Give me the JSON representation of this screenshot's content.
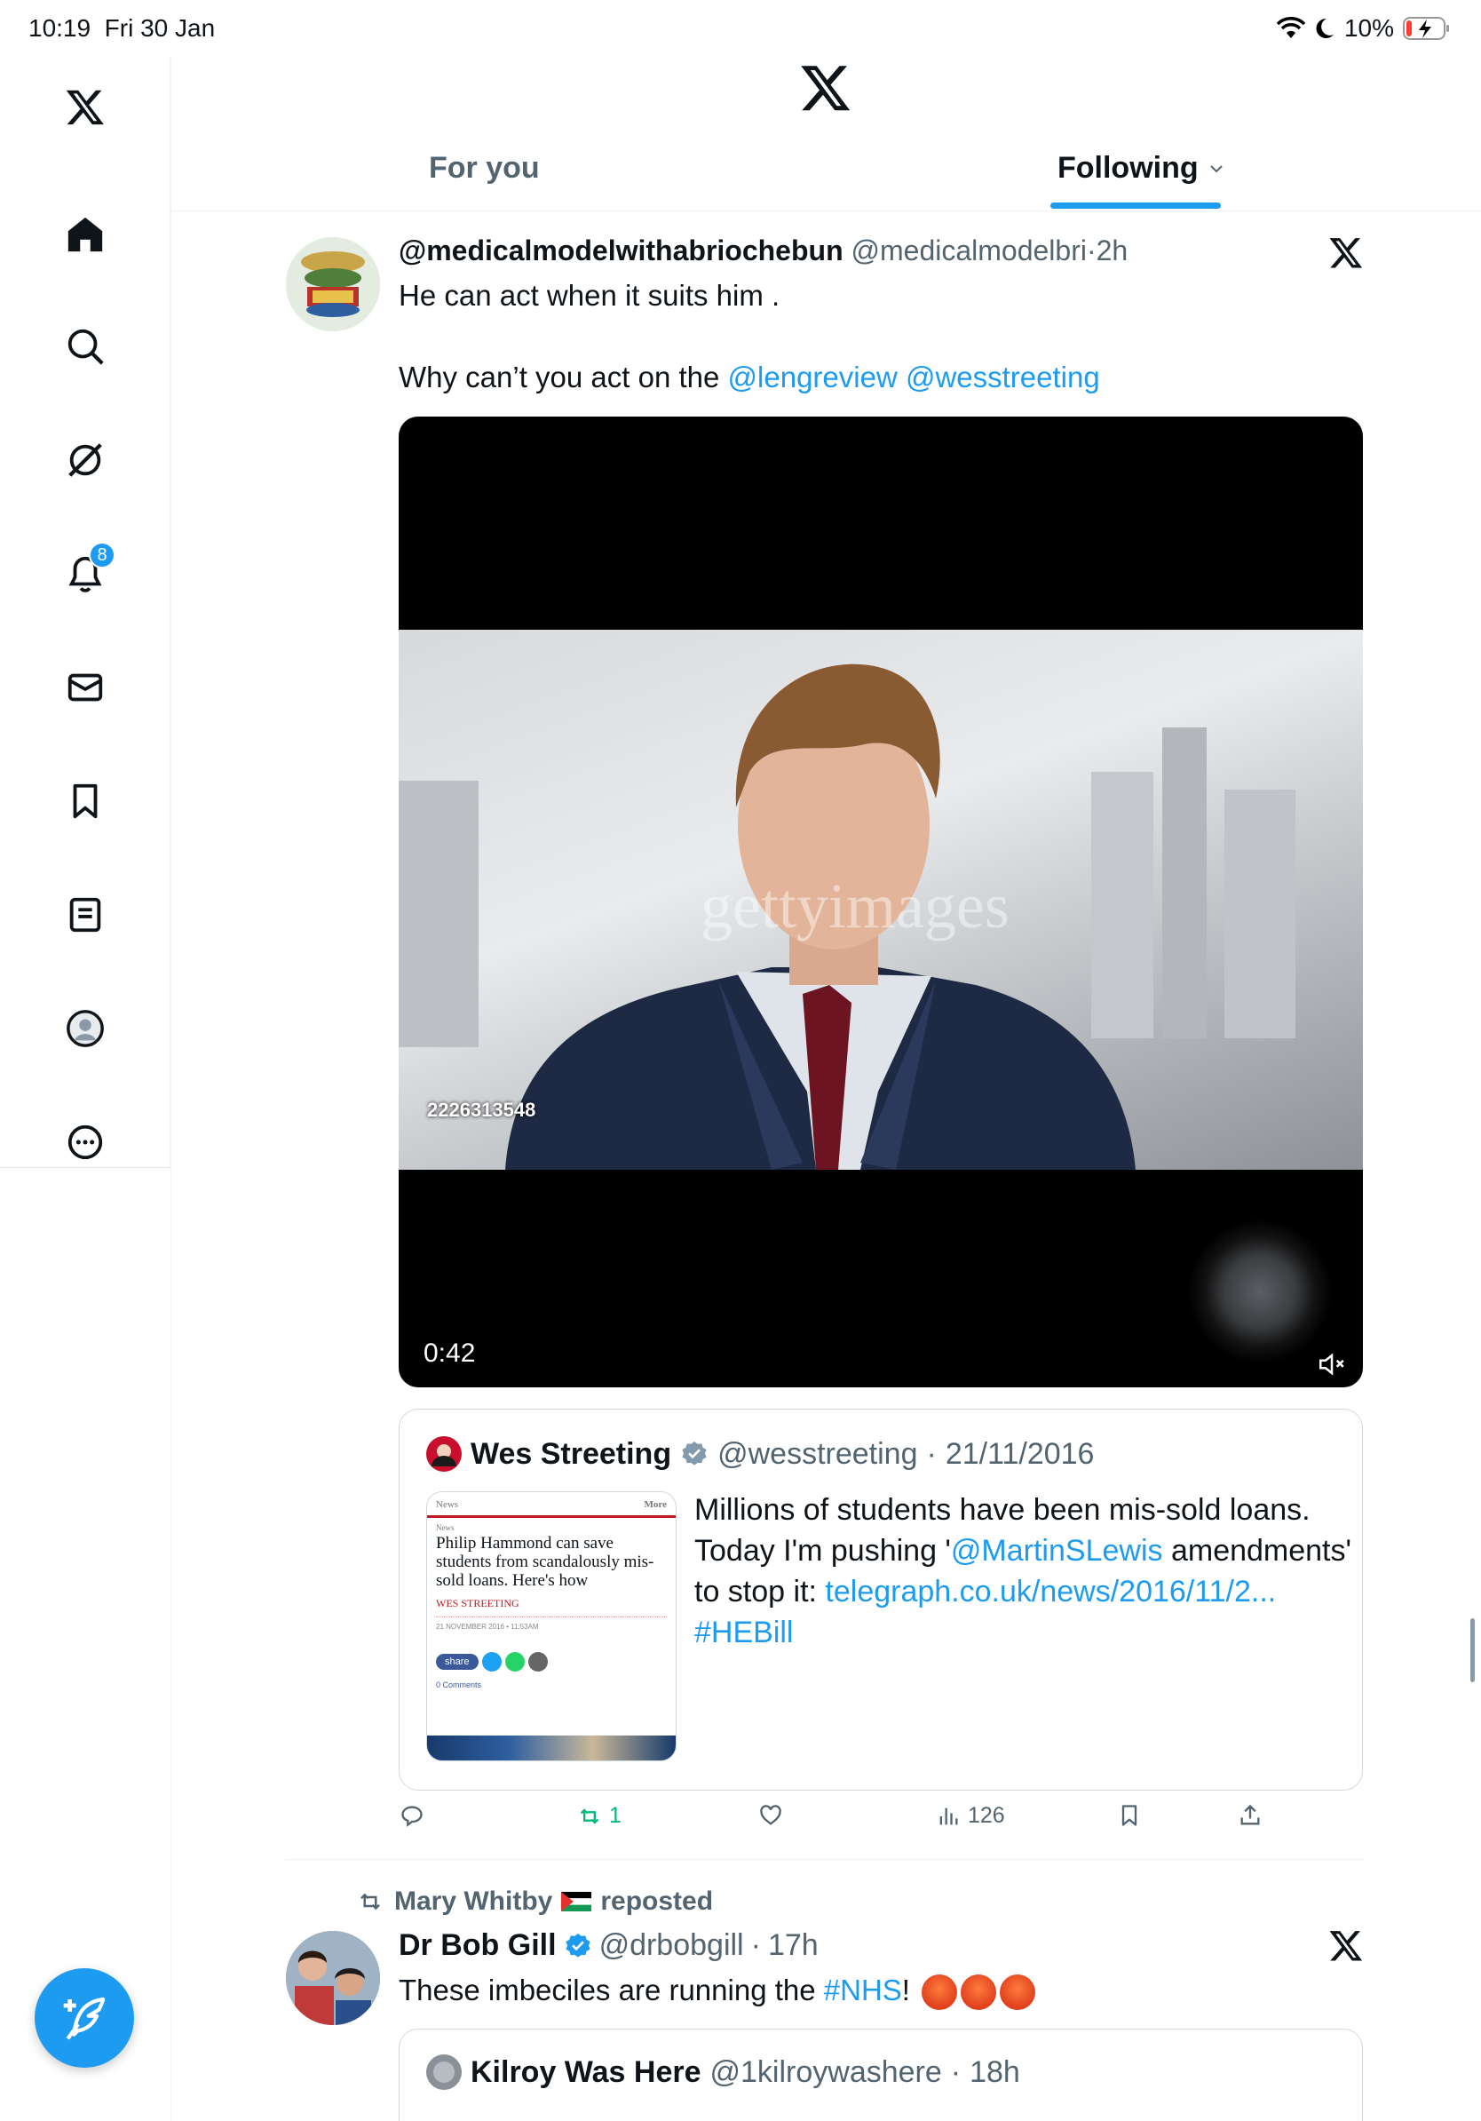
{
  "status_bar": {
    "time": "10:19",
    "date": "Fri 30 Jan",
    "battery": "10%"
  },
  "sidebar": {
    "items": [
      {
        "name": "x-logo-icon"
      },
      {
        "name": "home-icon"
      },
      {
        "name": "search-icon"
      },
      {
        "name": "grok-icon"
      },
      {
        "name": "notifications-icon",
        "badge": "8"
      },
      {
        "name": "messages-icon"
      },
      {
        "name": "bookmarks-icon"
      },
      {
        "name": "lists-icon"
      },
      {
        "name": "profile-icon"
      },
      {
        "name": "more-icon"
      }
    ]
  },
  "tabs": {
    "for_you": "For you",
    "following": "Following"
  },
  "tweet1": {
    "display_name": "@medicalmodelwithabriochebun",
    "handle": "@medicalmodelbri",
    "time": "2h",
    "text_line1": "He can act when it suits him .",
    "text_line2_prefix": "Why can’t you act on the ",
    "mention1": "@lengreview",
    "mention2": "@wesstreeting",
    "video": {
      "duration": "0:42",
      "image_id": "2226313548",
      "watermark": "gettyimages"
    },
    "quote": {
      "name": "Wes Streeting",
      "handle": "@wesstreeting",
      "date": "21/11/2016",
      "text_1": "Millions of students have been mis-sold loans. Today I'm pushing '",
      "mention": "@MartinSLewis",
      "text_2": " amendments' to stop it: ",
      "link": "telegraph.co.uk/news/2016/11/2...",
      "hashtag": "#HEBill",
      "thumb": {
        "section": "News",
        "more": "More",
        "breadcrumb": "News",
        "headline": "Philip Hammond can save students from scandalously mis-sold loans. Here's how",
        "author": "WES STREETING",
        "date": "21 NOVEMBER 2016 • 11:53AM",
        "share": "share",
        "comments": "0 Comments"
      }
    },
    "actions": {
      "reposts": "1",
      "views": "126"
    }
  },
  "tweet2": {
    "reposted_by": "Mary Whitby",
    "reposted_label": "reposted",
    "display_name": "Dr Bob Gill",
    "handle": "@drbobgill",
    "time": "17h",
    "text_prefix": "These imbeciles are running the ",
    "hashtag": "#NHS",
    "text_suffix": "!",
    "quote": {
      "name": "Kilroy Was Here",
      "handle": "@1kilroywashere",
      "time": "18h"
    }
  },
  "colors": {
    "accent": "#1d9bf0",
    "repost_green": "#00ba7c",
    "text": "#0f1419",
    "muted": "#536471"
  }
}
